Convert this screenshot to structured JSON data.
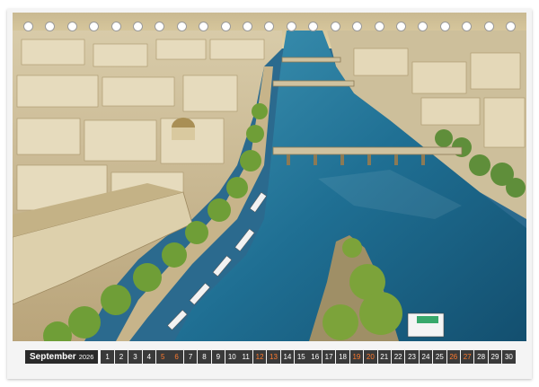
{
  "calendar": {
    "month": "September",
    "year": "2026",
    "days": [
      "1",
      "2",
      "3",
      "4",
      "5",
      "6",
      "7",
      "8",
      "9",
      "10",
      "11",
      "12",
      "13",
      "14",
      "15",
      "16",
      "17",
      "18",
      "19",
      "20",
      "21",
      "22",
      "23",
      "24",
      "25",
      "26",
      "27",
      "28",
      "29",
      "30"
    ],
    "weekend_days": [
      "5",
      "6",
      "12",
      "13",
      "19",
      "20",
      "26",
      "27"
    ],
    "weekend_color": "#ff7a2e"
  },
  "photo": {
    "subject": "aerial view of the Seine river with bridges and city buildings at golden hour"
  },
  "colors": {
    "river": "#1f6f93",
    "strip": "#3a3a3a"
  }
}
